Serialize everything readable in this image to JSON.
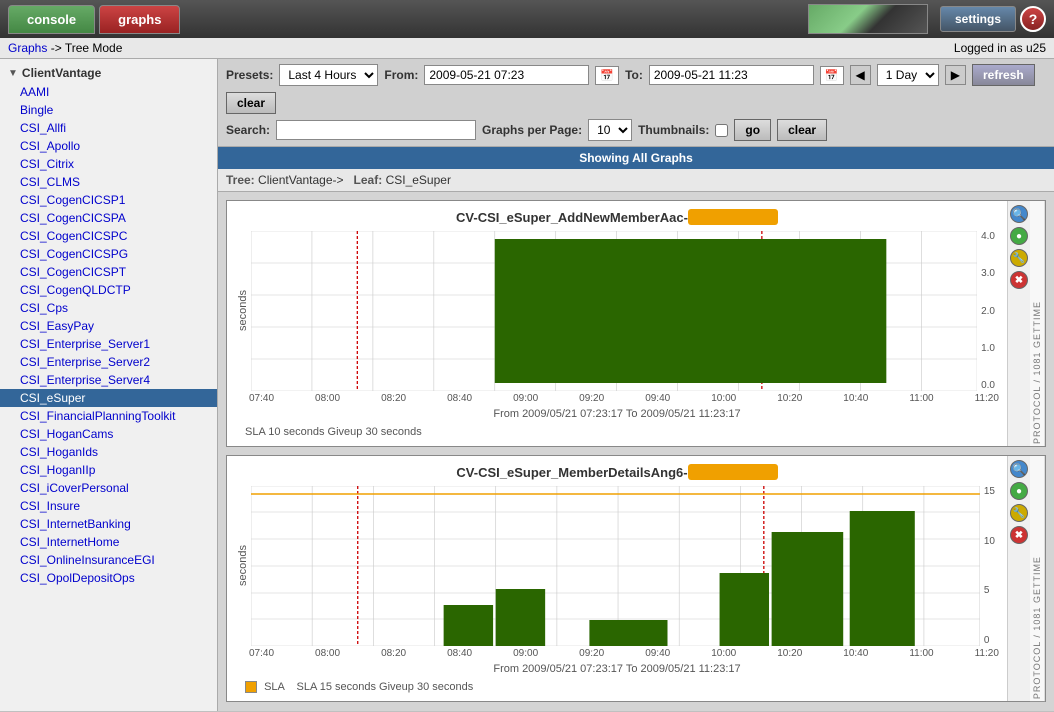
{
  "topbar": {
    "console_label": "console",
    "graphs_label": "graphs",
    "settings_label": "settings",
    "help_label": "?",
    "logged_in": "Logged in as u25"
  },
  "breadcrumb": {
    "graphs_link": "Graphs",
    "separator": " -> ",
    "mode": "Tree Mode"
  },
  "controls": {
    "presets_label": "Presets:",
    "presets_value": "Last 4 Hours",
    "from_label": "From:",
    "from_value": "2009-05-21 07:23",
    "to_label": "To:",
    "to_value": "2009-05-21 11:23",
    "day_value": "1 Day",
    "refresh_label": "refresh",
    "clear_label": "clear",
    "search_label": "Search:",
    "search_placeholder": "",
    "graphs_per_page_label": "Graphs per Page:",
    "graphs_per_page_value": "10",
    "thumbnails_label": "Thumbnails:",
    "go_label": "go",
    "clear2_label": "clear"
  },
  "showing_bar": {
    "text": "Showing All Graphs"
  },
  "tree_bar": {
    "tree_label": "Tree:",
    "tree_path": "ClientVantage->",
    "leaf_label": "Leaf:",
    "leaf_value": "CSI_eSuper"
  },
  "sidebar": {
    "root_label": "ClientVantage",
    "items": [
      {
        "label": "AAMI"
      },
      {
        "label": "Bingle"
      },
      {
        "label": "CSI_Allfi"
      },
      {
        "label": "CSI_Apollo"
      },
      {
        "label": "CSI_Citrix"
      },
      {
        "label": "CSI_CLMS"
      },
      {
        "label": "CSI_CogenCICSP1"
      },
      {
        "label": "CSI_CogenCICSPA"
      },
      {
        "label": "CSI_CogenCICSPC"
      },
      {
        "label": "CSI_CogenCICSPG"
      },
      {
        "label": "CSI_CogenCICSPT"
      },
      {
        "label": "CSI_CogenQLDCTP"
      },
      {
        "label": "CSI_Cps"
      },
      {
        "label": "CSI_EasyPay"
      },
      {
        "label": "CSI_Enterprise_Server1"
      },
      {
        "label": "CSI_Enterprise_Server2"
      },
      {
        "label": "CSI_Enterprise_Server4"
      },
      {
        "label": "CSI_eSuper",
        "selected": true
      },
      {
        "label": "CSI_FinancialPlanningToolkit"
      },
      {
        "label": "CSI_HoganCams"
      },
      {
        "label": "CSI_HoganIds"
      },
      {
        "label": "CSI_HoganIIp"
      },
      {
        "label": "CSI_iCoverPersonal"
      },
      {
        "label": "CSI_Insure"
      },
      {
        "label": "CSI_InternetBanking"
      },
      {
        "label": "CSI_InternetHome"
      },
      {
        "label": "CSI_OnlineInsuranceEGI"
      },
      {
        "label": "CSI_OpolDepositOps"
      }
    ]
  },
  "graphs": [
    {
      "id": "graph1",
      "title_prefix": "CV-CSI_eSuper_AddNewMemberAac-",
      "title_redacted": true,
      "y_label": "seconds",
      "y_ticks": [
        "4.0",
        "3.0",
        "2.0",
        "1.0",
        "0.0"
      ],
      "x_ticks": [
        "07:40",
        "08:00",
        "08:20",
        "08:40",
        "09:00",
        "09:20",
        "09:40",
        "10:00",
        "10:20",
        "10:40",
        "11:00",
        "11:20"
      ],
      "from_to": "From 2009/05/21 07:23:17 To 2009/05/21 11:23:17",
      "sla_text": "SLA 10 seconds   Giveup 30 seconds",
      "bars": [
        {
          "x": 0.38,
          "w": 0.5,
          "h": 0.95,
          "color": "#2a6600"
        }
      ],
      "side_label": "PROTOCOL / 1081 GETTIME"
    },
    {
      "id": "graph2",
      "title_prefix": "CV-CSI_eSuper_MemberDetailsAng6-",
      "title_redacted": true,
      "y_label": "seconds",
      "y_ticks": [
        "15",
        "",
        "10",
        "",
        "5",
        "",
        "0"
      ],
      "x_ticks": [
        "07:40",
        "08:00",
        "08:20",
        "08:40",
        "09:00",
        "09:20",
        "09:40",
        "10:00",
        "10:20",
        "10:40",
        "11:00",
        "11:20"
      ],
      "from_to": "From 2009/05/21 07:23:17 To 2009/05/21 11:23:17",
      "sla_label": "SLA",
      "sla_text": "SLA 15 seconds   Giveup 30 seconds",
      "has_sla_legend": true,
      "bars": [
        {
          "x": 0.28,
          "w": 0.08,
          "h": 0.28,
          "color": "#2a6600"
        },
        {
          "x": 0.36,
          "w": 0.08,
          "h": 0.38,
          "color": "#2a6600"
        },
        {
          "x": 0.52,
          "w": 0.16,
          "h": 0.18,
          "color": "#2a6600"
        },
        {
          "x": 0.68,
          "w": 0.08,
          "h": 0.52,
          "color": "#2a6600"
        },
        {
          "x": 0.76,
          "w": 0.12,
          "h": 0.72,
          "color": "#2a6600"
        },
        {
          "x": 0.88,
          "w": 0.1,
          "h": 0.85,
          "color": "#2a6600"
        }
      ],
      "side_label": "PROTOCOL / 1081 GETTIME"
    }
  ]
}
